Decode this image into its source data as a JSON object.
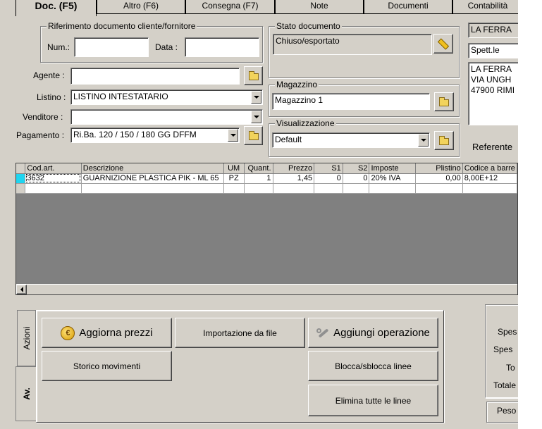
{
  "tabs": [
    "Doc. (F5)",
    "Altro (F6)",
    "Consegna (F7)",
    "Note",
    "Documenti",
    "Contabilità"
  ],
  "riferimento": {
    "legend": "Riferimento documento cliente/fornitore",
    "num_label": "Num.:",
    "num_value": "",
    "data_label": "Data :",
    "data_value": ""
  },
  "stato": {
    "legend": "Stato documento",
    "value": "Chiuso/esportato"
  },
  "agente": {
    "label": "Agente :",
    "value": ""
  },
  "listino": {
    "label": "Listino :",
    "value": "LISTINO INTESTATARIO"
  },
  "venditore": {
    "label": "Venditore :",
    "value": ""
  },
  "pagamento": {
    "label": "Pagamento :",
    "value": "Ri.Ba. 120 / 150 / 180 GG DFFM"
  },
  "magazzino": {
    "legend": "Magazzino",
    "value": "Magazzino 1"
  },
  "visualizzazione": {
    "legend": "Visualizzazione",
    "value": "Default"
  },
  "intestatario": {
    "name": "LA FERRA",
    "title": "Spett.le",
    "address_line1": "LA FERRA",
    "address_line2": "VIA UNGH",
    "address_line3": "47900 RIMI",
    "referente_label": "Referente"
  },
  "grid": {
    "columns": [
      "Cod.art.",
      "Descrizione",
      "UM",
      "Quant.",
      "Prezzo",
      "S1",
      "S2",
      "Imposte",
      "Plistino",
      "Codice a barre"
    ],
    "rows": [
      [
        "3632",
        "GUARNIZIONE PLASTICA PIK - ML   65",
        "PZ",
        "1",
        "1,45",
        "0",
        "0",
        "20% IVA",
        "0,00",
        "8,00E+12"
      ]
    ]
  },
  "side_tabs": {
    "azioni": "Azioni",
    "av": "Av."
  },
  "actions": {
    "aggiorna_prezzi": "Aggiorna prezzi",
    "importazione": "Importazione da file",
    "aggiungi_operazione": "Aggiungi operazione",
    "storico_movimenti": "Storico movimenti",
    "blocca_sblocca": "Blocca/sblocca linee",
    "elimina_linee": "Elimina tutte le linee"
  },
  "totals": {
    "spese1": "Spes",
    "spese2": "Spes",
    "to": "To",
    "totale": "Totale",
    "peso": "Peso"
  },
  "icons": {
    "stato_button": "pencil-icon",
    "folder": "folder-icon",
    "aggiorna": "euro-coin-icon",
    "aggiungi": "wrench-icon"
  }
}
